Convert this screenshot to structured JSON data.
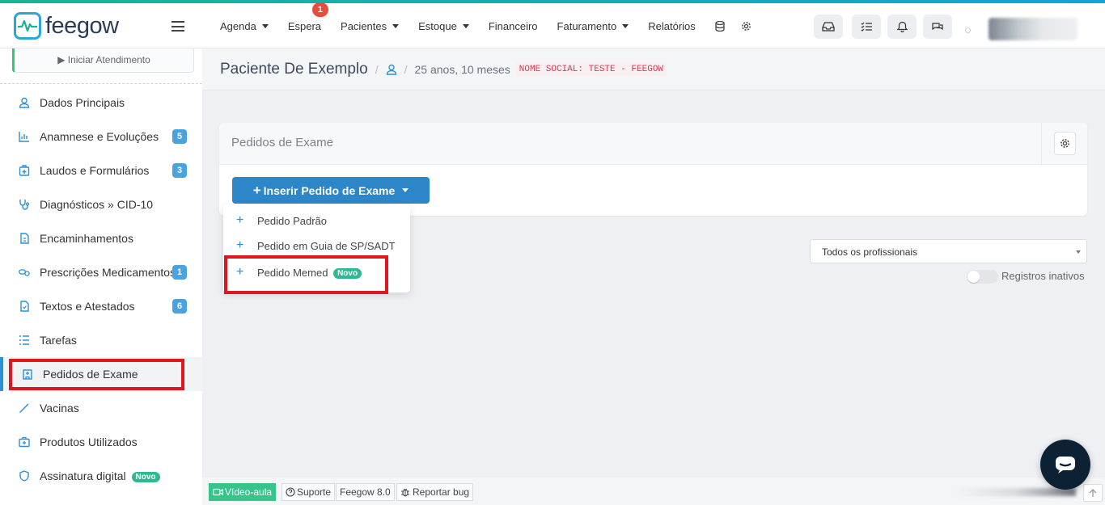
{
  "app": {
    "brand": "feegow"
  },
  "nav": {
    "items": [
      {
        "label": "Agenda",
        "caret": true
      },
      {
        "label": "Espera",
        "caret": false,
        "badge": "1"
      },
      {
        "label": "Pacientes",
        "caret": true
      },
      {
        "label": "Estoque",
        "caret": true
      },
      {
        "label": "Financeiro",
        "caret": false
      },
      {
        "label": "Faturamento",
        "caret": true
      },
      {
        "label": "Relatórios",
        "caret": false
      }
    ],
    "icons": [
      "database-icon",
      "gear-icon"
    ],
    "right_buttons": [
      "inbox-icon",
      "tasks-icon",
      "bell-icon",
      "chat-icon"
    ]
  },
  "sidebar": {
    "iniciar_label": "▶ Iniciar Atendimento",
    "items": [
      {
        "label": "Dados Principais",
        "icon": "user-icon"
      },
      {
        "label": "Anamnese e Evoluções",
        "icon": "chart-icon",
        "badge": "5"
      },
      {
        "label": "Laudos e Formulários",
        "icon": "medkit-icon",
        "badge": "3"
      },
      {
        "label": "Diagnósticos » CID-10",
        "icon": "stethoscope-icon"
      },
      {
        "label": "Encaminhamentos",
        "icon": "document-icon"
      },
      {
        "label": "Prescrições Medicamentos",
        "icon": "pills-icon",
        "badge": "1"
      },
      {
        "label": "Textos e Atestados",
        "icon": "file-icon",
        "badge": "6"
      },
      {
        "label": "Tarefas",
        "icon": "list-icon"
      },
      {
        "label": "Pedidos de Exame",
        "icon": "hospital-icon",
        "active": true
      },
      {
        "label": "Vacinas",
        "icon": "syringe-icon"
      },
      {
        "label": "Produtos Utilizados",
        "icon": "kit-icon"
      },
      {
        "label": "Assinatura digital",
        "icon": "shield-icon",
        "pill": "Novo"
      }
    ]
  },
  "breadcrumb": {
    "patient_name": "Paciente De Exemplo",
    "separator": "/",
    "age": "25 anos, 10 meses",
    "social_name": "NOME SOCIAL: TESTE - FEEGOW"
  },
  "panel": {
    "title": "Pedidos de Exame",
    "insert_button": "Inserir Pedido de Exame"
  },
  "dropdown": {
    "items": [
      {
        "label": "Pedido Padrão"
      },
      {
        "label": "Pedido em Guia de SP/SADT"
      },
      {
        "label": "Pedido Memed",
        "pill": "Novo"
      }
    ]
  },
  "filter": {
    "professional_select": "Todos os profissionais",
    "inactive_toggle_label": "Registros inativos",
    "inactive_toggle_on": false
  },
  "footer": {
    "video": "Vídeo-aula",
    "support": "Suporte",
    "version": "Feegow 8.0",
    "report": "Reportar bug"
  },
  "colors": {
    "primary": "#2c86c8",
    "highlight": "#e0161e",
    "badge": "#4aa3df",
    "novo": "#2fb893"
  }
}
